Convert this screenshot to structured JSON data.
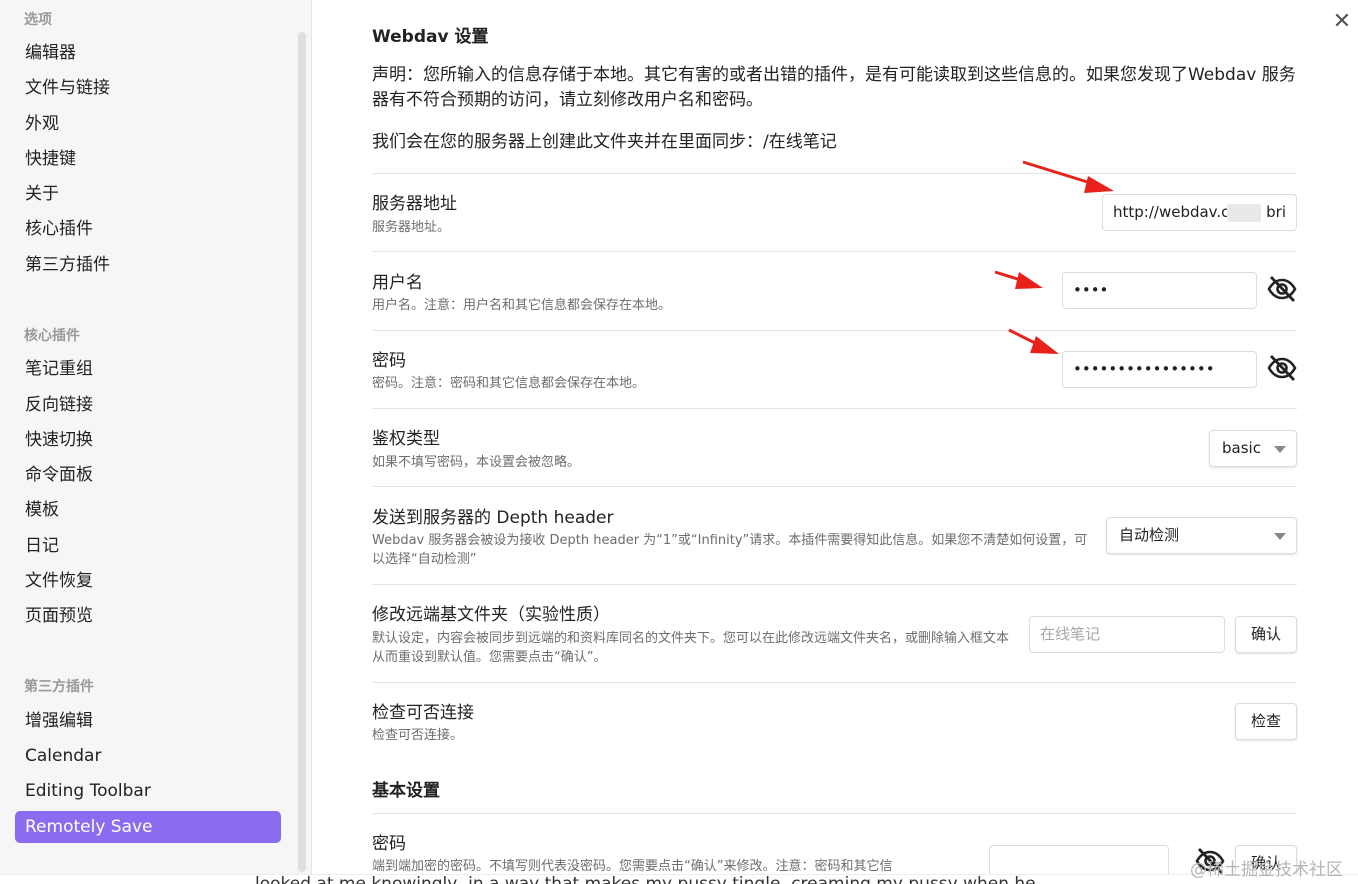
{
  "sidebar": {
    "section_options": "选项",
    "options": [
      "编辑器",
      "文件与链接",
      "外观",
      "快捷键",
      "关于",
      "核心插件",
      "第三方插件"
    ],
    "section_core": "核心插件",
    "core": [
      "笔记重组",
      "反向链接",
      "快速切换",
      "命令面板",
      "模板",
      "日记",
      "文件恢复",
      "页面预览"
    ],
    "section_community": "第三方插件",
    "community": [
      "增强编辑",
      "Calendar",
      "Editing Toolbar",
      "Remotely Save"
    ],
    "active_item": "Remotely Save"
  },
  "main": {
    "title": "Webdav 设置",
    "disclaimer": "声明：您所输入的信息存储于本地。其它有害的或者出错的插件，是有可能读取到这些信息的。如果您发现了Webdav 服务器有不符合预期的访问，请立刻修改用户名和密码。",
    "folder_note": "我们会在您的服务器上创建此文件夹并在里面同步：/在线笔记",
    "settings": {
      "server": {
        "name": "服务器地址",
        "desc": "服务器地址。",
        "value": "http://webdav.c",
        "value_tail": "bri"
      },
      "username": {
        "name": "用户名",
        "desc": "用户名。注意：用户名和其它信息都会保存在本地。",
        "value": "••••"
      },
      "password": {
        "name": "密码",
        "desc": "密码。注意：密码和其它信息都会保存在本地。",
        "value": "••••••••••••••••"
      },
      "auth": {
        "name": "鉴权类型",
        "desc": "如果不填写密码，本设置会被忽略。",
        "selected": "basic"
      },
      "depth": {
        "name": "发送到服务器的 Depth header",
        "desc": "Webdav 服务器会被设为接收 Depth header 为“1”或“Infinity”请求。本插件需要得知此信息。如果您不清楚如何设置，可以选择“自动检测”",
        "selected": "自动检测"
      },
      "remote_base": {
        "name": "修改远端基文件夹（实验性质）",
        "desc": "默认设定，内容会被同步到远端的和资料库同名的文件夹下。您可以在此修改远端文件夹名，或删除输入框文本从而重设到默认值。您需要点击“确认”。",
        "placeholder": "在线笔记",
        "button": "确认"
      },
      "check": {
        "name": "检查可否连接",
        "desc": "检查可否连接。",
        "button": "检查"
      }
    },
    "basic_title": "基本设置",
    "basic_password": {
      "name": "密码",
      "desc": "端到端加密的密码。不填写则代表没密码。您需要点击“确认”来修改。注意：密码和其它信",
      "button": "确认"
    }
  },
  "overlay": {
    "bottom_text": "looked at me knowingly, in a way that makes my pussy tingle, creaming my pussy when he",
    "watermark": "@稀土掘金技术社区"
  },
  "colors": {
    "accent": "#8b6cf0",
    "arrow": "#e8221b"
  },
  "icons": {
    "close": "close-icon",
    "eye": "eye-off-icon",
    "dropdown": "chevron-down-icon"
  }
}
